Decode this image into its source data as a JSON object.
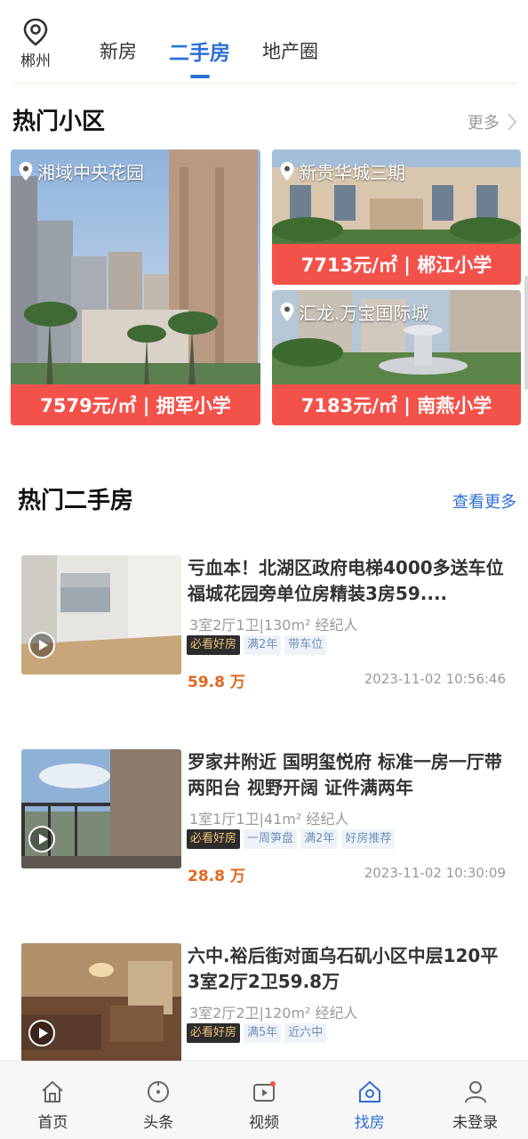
{
  "header": {
    "location": "郴州",
    "tabs": [
      {
        "label": "新房"
      },
      {
        "label": "二手房"
      },
      {
        "label": "地产圈"
      }
    ],
    "active_tab": 1
  },
  "hot_communities": {
    "title": "热门小区",
    "more_label": "更多",
    "items": [
      {
        "name": "湘域中央花园",
        "price": "7579元/㎡ | 拥军小学"
      },
      {
        "name": "新贵华城三期",
        "price": "7713元/㎡ | 郴江小学"
      },
      {
        "name": "汇龙.万宝国际城",
        "price": "7183元/㎡ | 南燕小学"
      }
    ]
  },
  "hot_listings": {
    "title": "热门二手房",
    "more_label": "查看更多",
    "items": [
      {
        "title": "亏血本！北湖区政府电梯4000多送车位福城花园旁单位房精装3房59....",
        "meta": "3室2厅1卫|130m²   经纪人",
        "tags": [
          "必看好房",
          "满2年",
          "带车位"
        ],
        "price": "59.8 万",
        "time": "2023-11-02 10:56:46"
      },
      {
        "title": "罗家井附近 国明玺悦府 标准一房一厅带两阳台 视野开阔 证件满两年",
        "meta": "1室1厅1卫|41m²   经纪人",
        "tags": [
          "必看好房",
          "一周笋盘",
          "满2年",
          "好房推荐"
        ],
        "price": "28.8 万",
        "time": "2023-11-02 10:30:09"
      },
      {
        "title": "六中.裕后街对面乌石矶小区中层120平3室2厅2卫59.8万",
        "meta": "3室2厅2卫|120m²   经纪人",
        "tags": [
          "必看好房",
          "满5年",
          "近六中"
        ],
        "price": "",
        "time": ""
      }
    ]
  },
  "bottom_nav": [
    {
      "label": "首页",
      "icon": "home-icon"
    },
    {
      "label": "头条",
      "icon": "headline-icon"
    },
    {
      "label": "视频",
      "icon": "video-icon"
    },
    {
      "label": "找房",
      "icon": "find-house-icon"
    },
    {
      "label": "未登录",
      "icon": "user-icon"
    }
  ],
  "colors": {
    "accent": "#2d6fd6",
    "price_banner": "#f3524b",
    "listing_price": "#e2661f",
    "tag_dark_bg": "#2c2c2c",
    "tag_light_bg": "#eef3f9"
  }
}
